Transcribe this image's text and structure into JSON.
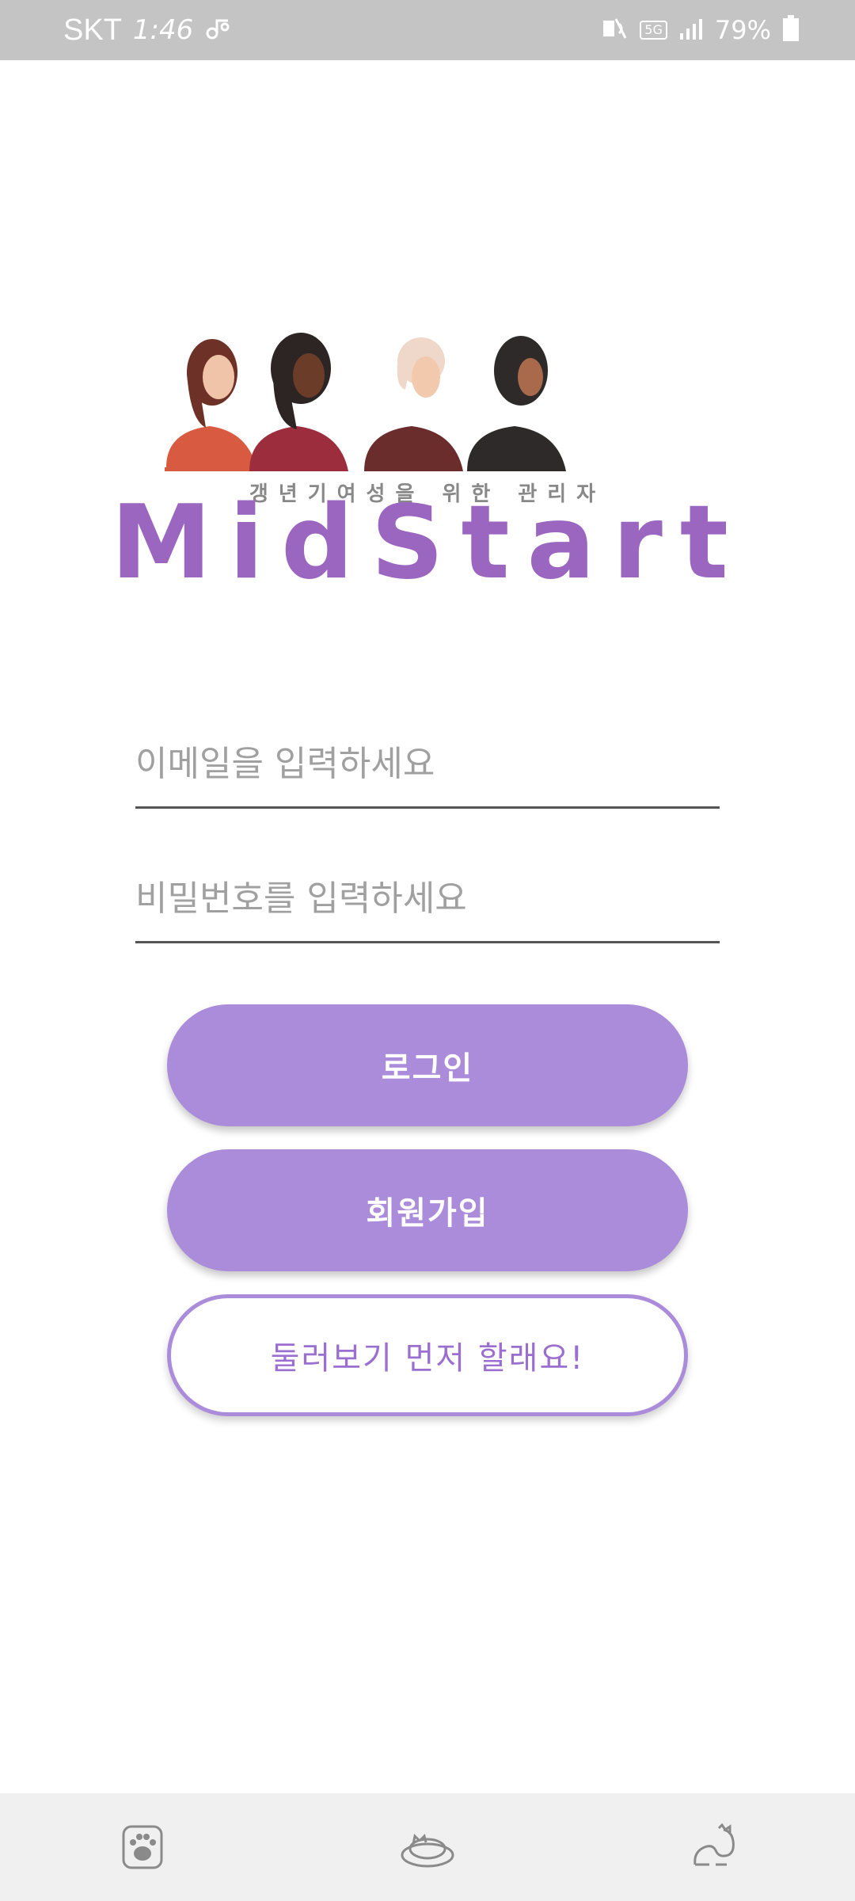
{
  "status_bar": {
    "carrier": "SKT",
    "time": "1:46",
    "network": "5G",
    "battery": "79%"
  },
  "logo": {
    "tagline": "갱년기여성을 위한 관리자",
    "brand_letters": [
      "M",
      "i",
      "d",
      "S",
      "t",
      "a",
      "r",
      "t"
    ]
  },
  "form": {
    "email_placeholder": "이메일을 입력하세요",
    "password_placeholder": "비밀번호를 입력하세요"
  },
  "buttons": {
    "login": "로그인",
    "signup": "회원가입",
    "browse": "둘러보기 먼저 할래요!"
  },
  "bottom_nav": {
    "items": [
      "paw-icon",
      "sleeping-cat-icon",
      "stretching-cat-icon"
    ]
  },
  "colors": {
    "accent": "#aa8cda",
    "brand_text": "#9b66c0"
  }
}
